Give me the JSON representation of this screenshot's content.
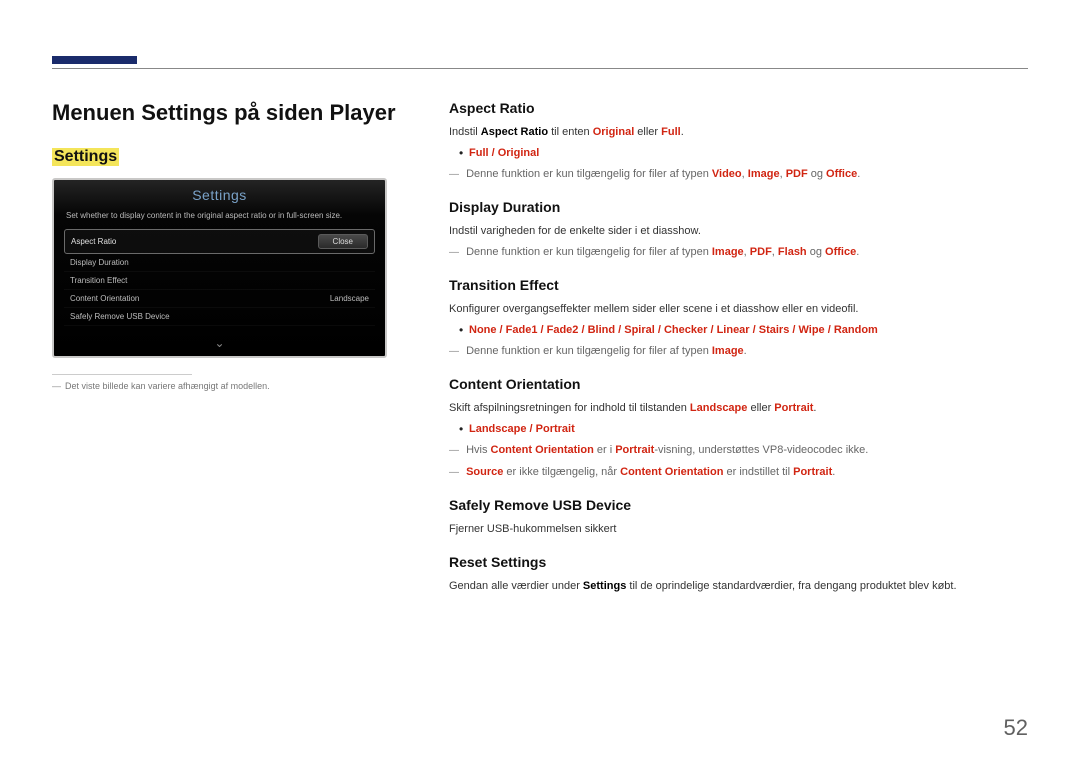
{
  "page_number": "52",
  "left": {
    "title": "Menuen Settings på siden Player",
    "settings_label": "Settings",
    "caption": "Det viste billede kan variere afhængigt af modellen.",
    "shot": {
      "title": "Settings",
      "subtext": "Set whether to display content in the original aspect ratio or in full-screen size.",
      "rows": {
        "aspect_ratio": "Aspect Ratio",
        "display_duration": "Display Duration",
        "transition_effect": "Transition Effect",
        "content_orientation": "Content Orientation",
        "content_orientation_val": "Landscape",
        "safely_remove": "Safely Remove USB Device"
      },
      "close": "Close"
    }
  },
  "sections": {
    "aspect_ratio": {
      "head": "Aspect Ratio",
      "p1a": "Indstil ",
      "p1b": "Aspect Ratio",
      "p1c": " til enten ",
      "p1d": "Original",
      "p1e": " eller ",
      "p1f": "Full",
      "p1g": ".",
      "bullet": "Full / Original",
      "note_a": "Denne funktion er kun tilgængelig for filer af typen ",
      "note_b": "Video",
      "note_c": ", ",
      "note_d": "Image",
      "note_e": ", ",
      "note_f": "PDF",
      "note_g": " og ",
      "note_h": "Office",
      "note_i": "."
    },
    "display_duration": {
      "head": "Display Duration",
      "p1": "Indstil varigheden for de enkelte sider i et diasshow.",
      "note_a": "Denne funktion er kun tilgængelig for filer af typen ",
      "note_b": "Image",
      "note_c": ", ",
      "note_d": "PDF",
      "note_e": ", ",
      "note_f": "Flash",
      "note_g": " og ",
      "note_h": "Office",
      "note_i": "."
    },
    "transition_effect": {
      "head": "Transition Effect",
      "p1": "Konfigurer overgangseffekter mellem sider eller scene i et diasshow eller en videofil.",
      "bullet": "None / Fade1 / Fade2 / Blind / Spiral / Checker / Linear / Stairs / Wipe / Random",
      "note_a": "Denne funktion er kun tilgængelig for filer af typen ",
      "note_b": "Image",
      "note_c": "."
    },
    "content_orientation": {
      "head": "Content Orientation",
      "p1a": "Skift afspilningsretningen for indhold til tilstanden ",
      "p1b": "Landscape",
      "p1c": " eller ",
      "p1d": "Portrait",
      "p1e": ".",
      "bullet": "Landscape / Portrait",
      "note1_a": "Hvis ",
      "note1_b": "Content Orientation",
      "note1_c": " er i ",
      "note1_d": "Portrait",
      "note1_e": "-visning, understøttes VP8-videocodec ikke.",
      "note2_a": "Source",
      "note2_b": " er ikke tilgængelig, når ",
      "note2_c": "Content Orientation",
      "note2_d": " er indstillet til ",
      "note2_e": "Portrait",
      "note2_f": "."
    },
    "safely_remove": {
      "head": "Safely Remove USB Device",
      "p1": "Fjerner USB-hukommelsen sikkert"
    },
    "reset_settings": {
      "head": "Reset Settings",
      "p1a": "Gendan alle værdier under ",
      "p1b": "Settings",
      "p1c": " til de oprindelige standardværdier, fra dengang produktet blev købt."
    }
  }
}
